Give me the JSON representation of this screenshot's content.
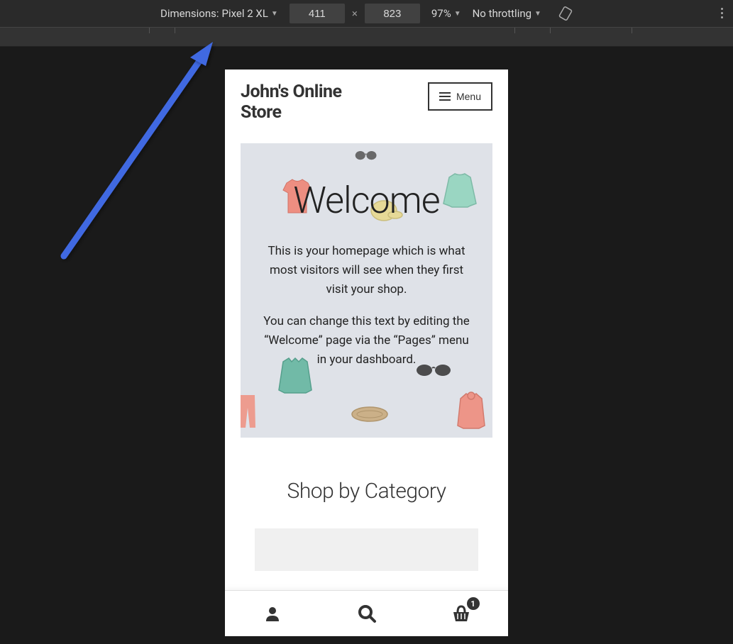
{
  "devtools": {
    "dimensions_label": "Dimensions:",
    "device_name": "Pixel 2 XL",
    "width": "411",
    "height": "823",
    "zoom": "97%",
    "throttling": "No throttling"
  },
  "site": {
    "title": "John's Online Store",
    "menu_label": "Menu"
  },
  "hero": {
    "heading": "Welcome",
    "paragraph1": "This is your homepage which is what most visitors will see when they first visit your shop.",
    "paragraph2": "You can change this text by editing the “Welcome” page via the “Pages” menu in your dashboard."
  },
  "category": {
    "heading": "Shop by Category"
  },
  "bottom_nav": {
    "cart_count": "1"
  }
}
